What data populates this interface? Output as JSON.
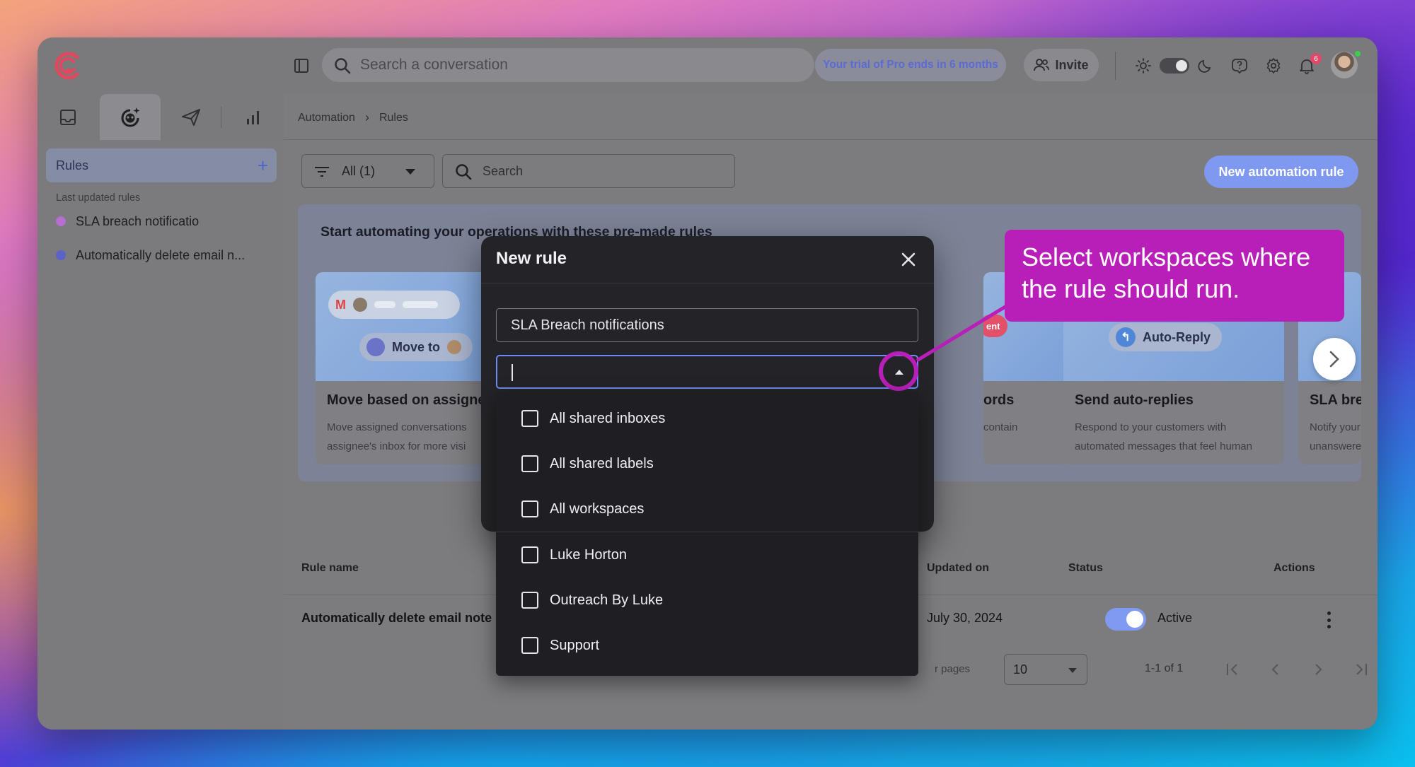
{
  "topbar": {
    "search_placeholder": "Search a conversation",
    "trial_text": "Your trial of Pro ends in 6 months",
    "invite_label": "Invite",
    "notification_count": "6",
    "icons": [
      "logo-icon",
      "sidebar-toggle-icon",
      "search-icon",
      "invite-user-icon",
      "sun-icon",
      "theme-toggle",
      "moon-icon",
      "help-icon",
      "gear-icon",
      "bell-icon",
      "avatar"
    ]
  },
  "nav_tabs": [
    "inbox-icon",
    "automation-bot-icon",
    "send-icon",
    "analytics-icon"
  ],
  "sidebar": {
    "title": "Rules",
    "last_updated_label": "Last updated rules",
    "items": [
      {
        "label": "SLA breach notificatio",
        "color": "#b56fd0"
      },
      {
        "label": "Automatically delete email n...",
        "color": "#5c62c8"
      }
    ]
  },
  "breadcrumb": {
    "items": [
      "Automation",
      "Rules"
    ]
  },
  "toolbar": {
    "filter_label": "All (1)",
    "search_placeholder": "Search",
    "new_rule_label": "New automation rule"
  },
  "promo": {
    "title": "Start automating your operations with these pre-made rules",
    "cards": [
      {
        "title": "Move based on assignee",
        "desc_1": "Move assigned conversations",
        "desc_2": "assignee's inbox for more visi",
        "chip": "Move to"
      },
      {
        "title": "ords",
        "desc_1": "contain",
        "desc_2": "",
        "chip": "ent"
      },
      {
        "title": "Send auto-replies",
        "desc_1": "Respond to your customers with",
        "desc_2": "automated messages that feel human",
        "chip": "Auto-Reply"
      },
      {
        "title": "SLA breac",
        "desc_1": "Notify your te",
        "desc_2": "unanswered a",
        "chip": ""
      }
    ]
  },
  "table": {
    "headers": {
      "rule_name": "Rule name",
      "updated_on": "Updated on",
      "status": "Status",
      "actions": "Actions"
    },
    "rows": [
      {
        "name": "Automatically delete email note r",
        "updated_on": "July 30, 2024",
        "status": "Active"
      }
    ],
    "per_pages_label": "r pages",
    "page_size": "10",
    "range": "1-1 of 1"
  },
  "modal": {
    "title": "New rule",
    "name_value": "SLA Breach notifications",
    "workspace_value": "",
    "options": [
      "All shared inboxes",
      "All shared labels",
      "All workspaces",
      "Luke Horton",
      "Outreach By Luke",
      "Support"
    ]
  },
  "callout": {
    "line_1": "Select workspaces where",
    "line_2": "the rule should run.",
    "color": "#b81fb8"
  },
  "colors": {
    "accent": "#7f98f0",
    "brand": "#e0485e"
  }
}
